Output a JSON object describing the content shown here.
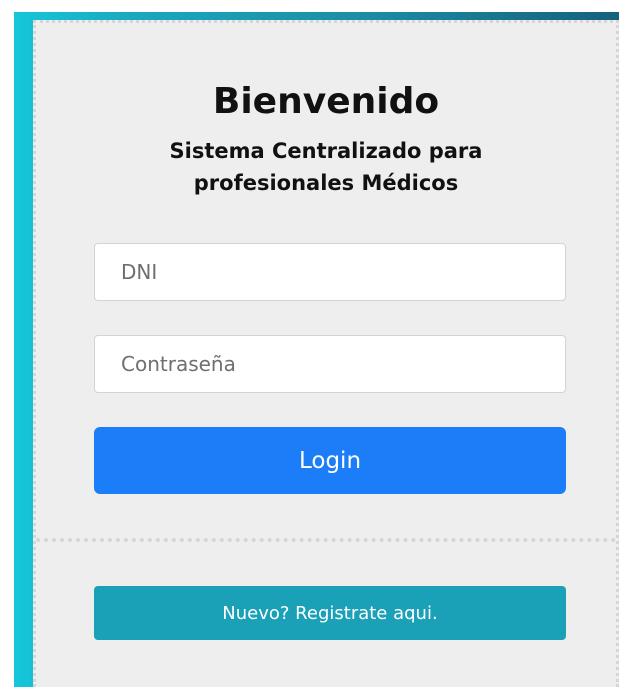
{
  "header": {
    "title": "Bienvenido",
    "subtitle_line1": "Sistema Centralizado para",
    "subtitle_line2": "profesionales Médicos"
  },
  "form": {
    "dni_placeholder": "DNI",
    "password_placeholder": "Contraseña",
    "login_label": "Login"
  },
  "footer": {
    "register_label": "Nuevo? Registrate aqui."
  },
  "colors": {
    "primary": "#1b7ef8",
    "info": "#1aa1b8",
    "frame": "#1c8fa8",
    "card": "#eeeeee"
  }
}
